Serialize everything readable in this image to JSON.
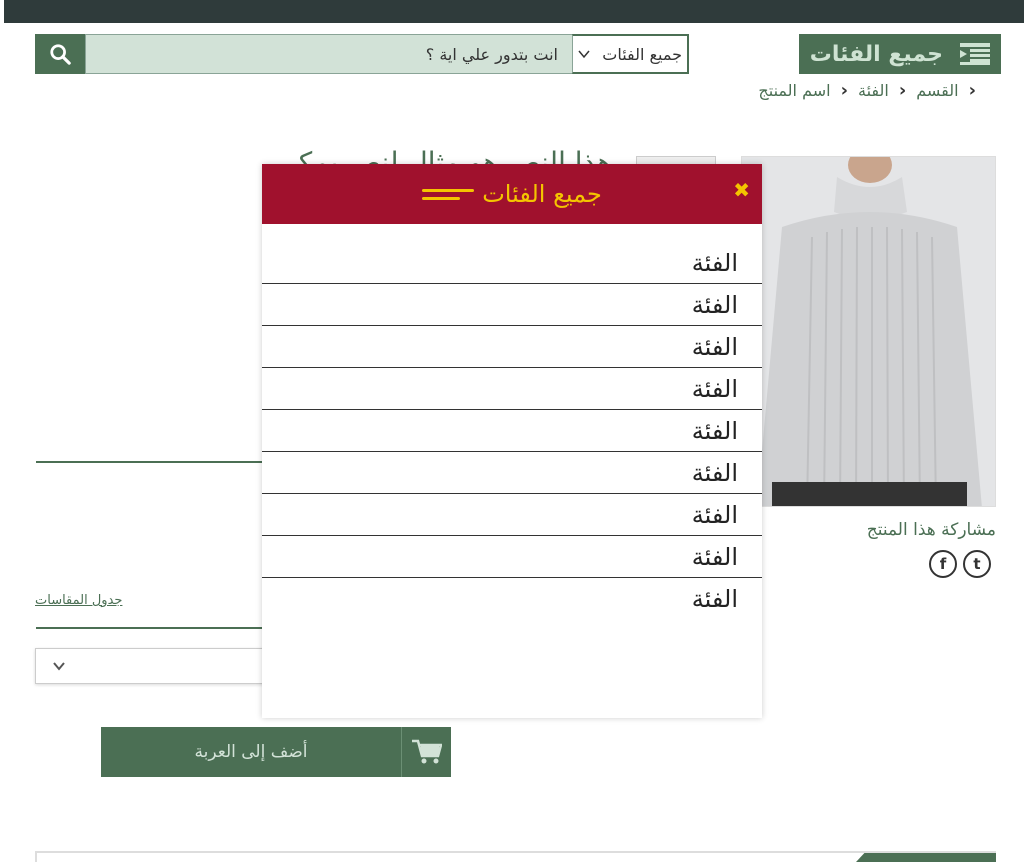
{
  "header": {
    "search_placeholder": "انت بتدور علي اية ؟",
    "category_select": "جميع الفئات",
    "all_categories_label": "جميع الفئات"
  },
  "breadcrumb": {
    "items": [
      "القسم",
      "الفئة",
      "اسم المنتج"
    ]
  },
  "product": {
    "title": "هذا النص هو مثال لنص يمكن",
    "share_label": "مشاركة هذا المنتج",
    "size_chart_label": "جدول المقاسات",
    "add_to_cart_label": "أضف إلى العربة"
  },
  "social": {
    "facebook": "f",
    "twitter": "t"
  },
  "modal": {
    "title": "جميع الفئات",
    "close_glyph": "✖",
    "items": [
      "الفئة",
      "الفئة",
      "الفئة",
      "الفئة",
      "الفئة",
      "الفئة",
      "الفئة",
      "الفئة",
      "الفئة"
    ]
  },
  "colors": {
    "primary": "#4b6f54",
    "modal_header": "#a0112d",
    "accent": "#f4c400",
    "topbar": "#2f3b3b"
  },
  "icons": {
    "search": "search-icon",
    "all_categories": "list-icon",
    "cart": "cart-icon",
    "close": "close-icon",
    "menu": "menu-icon"
  }
}
